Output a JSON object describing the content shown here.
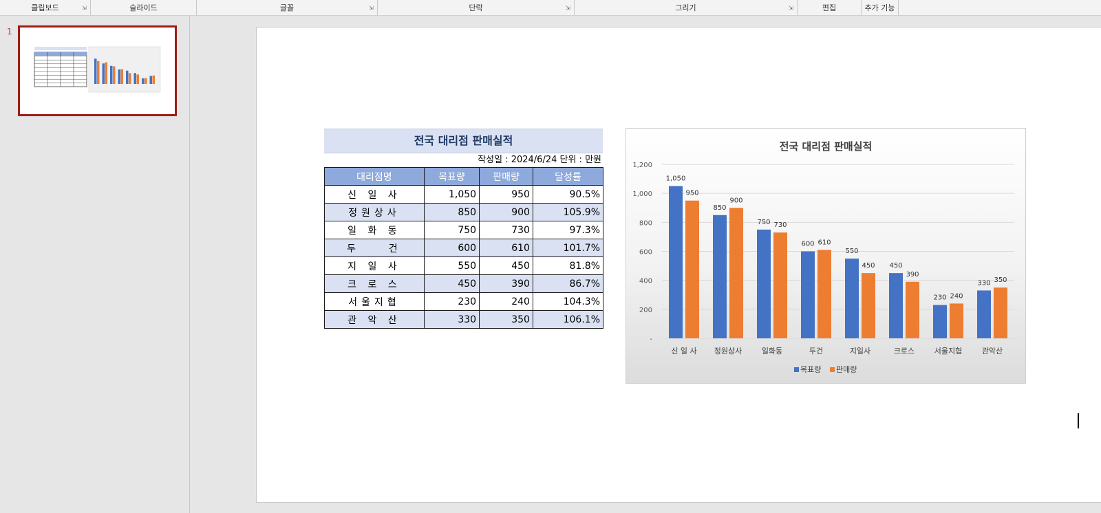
{
  "ribbon": {
    "groups": [
      {
        "label": "클립보드"
      },
      {
        "label": "슬라이드"
      },
      {
        "label": "글꼴"
      },
      {
        "label": "단락"
      },
      {
        "label": "그리기"
      },
      {
        "label": "편집"
      },
      {
        "label": "추가 기능"
      }
    ]
  },
  "thumbnails": {
    "slide_number": "1"
  },
  "table": {
    "title": "전국 대리점 판매실적",
    "meta": "작성일 : 2024/6/24  단위 : 만원",
    "headers": [
      "대리점명",
      "목표량",
      "판매량",
      "달성률"
    ],
    "rows": [
      [
        "신 일 사",
        "1,050",
        "950",
        "90.5%"
      ],
      [
        "정원상사",
        "850",
        "900",
        "105.9%"
      ],
      [
        "일 화 동",
        "750",
        "730",
        "97.3%"
      ],
      [
        "두    건",
        "600",
        "610",
        "101.7%"
      ],
      [
        "지 일 사",
        "550",
        "450",
        "81.8%"
      ],
      [
        "크 로 스",
        "450",
        "390",
        "86.7%"
      ],
      [
        "서울지협",
        "230",
        "240",
        "104.3%"
      ],
      [
        "관 악 산",
        "330",
        "350",
        "106.1%"
      ]
    ]
  },
  "chart_data": {
    "type": "bar",
    "title": "전국 대리점 판매실적",
    "categories": [
      "신 일 사",
      "정원상사",
      "일화동",
      "두건",
      "지일사",
      "크로스",
      "서울지협",
      "관악산"
    ],
    "series": [
      {
        "name": "목표량",
        "values": [
          1050,
          850,
          750,
          600,
          550,
          450,
          230,
          330
        ],
        "color": "#4472c4"
      },
      {
        "name": "판매량",
        "values": [
          950,
          900,
          730,
          610,
          450,
          390,
          240,
          350
        ],
        "color": "#ed7d31"
      }
    ],
    "ylim": [
      0,
      1200
    ],
    "yticks": [
      "-",
      "200",
      "400",
      "600",
      "800",
      "1,000",
      "1,200"
    ],
    "grid": true,
    "legend": "bottom"
  }
}
